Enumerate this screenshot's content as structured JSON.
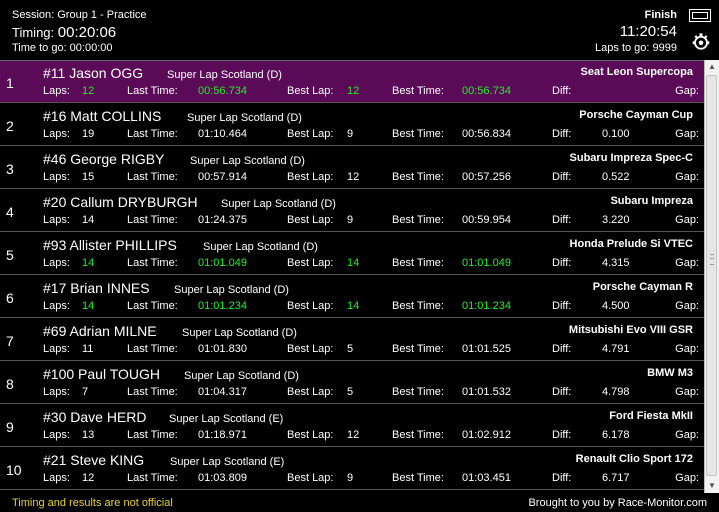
{
  "header": {
    "session": "Session: Group 1 - Practice",
    "timing_label": "Timing:",
    "timing_value": "00:20:06",
    "time_to_go": "Time to go: 00:00:00",
    "finish": "Finish",
    "clock": "11:20:54",
    "laps_to_go": "Laps to go:  9999"
  },
  "labels": {
    "laps": "Laps:",
    "last_time": "Last Time:",
    "best_lap": "Best Lap:",
    "best_time": "Best Time:",
    "diff": "Diff:",
    "gap": "Gap:"
  },
  "rows": [
    {
      "pos": "1",
      "name": "#11 Jason OGG",
      "category": "Super Lap Scotland (D)",
      "car": "Seat Leon Supercopa",
      "laps": "12",
      "last_time": "00:56.734",
      "best_lap": "12",
      "best_time": "00:56.734",
      "diff": ""
    },
    {
      "pos": "2",
      "name": "#16 Matt COLLINS",
      "category": "Super Lap Scotland (D)",
      "car": "Porsche Cayman Cup",
      "laps": "19",
      "last_time": "01:10.464",
      "best_lap": "9",
      "best_time": "00:56.834",
      "diff": "0.100"
    },
    {
      "pos": "3",
      "name": "#46 George RIGBY",
      "category": "Super Lap Scotland (D)",
      "car": "Subaru Impreza Spec-C",
      "laps": "15",
      "last_time": "00:57.914",
      "best_lap": "12",
      "best_time": "00:57.256",
      "diff": "0.522"
    },
    {
      "pos": "4",
      "name": "#20 Callum DRYBURGH",
      "category": "Super Lap Scotland (D)",
      "car": "Subaru Impreza",
      "laps": "14",
      "last_time": "01:24.375",
      "best_lap": "9",
      "best_time": "00:59.954",
      "diff": "3.220"
    },
    {
      "pos": "5",
      "name": "#93 Allister PHILLIPS",
      "category": "Super Lap Scotland (D)",
      "car": "Honda Prelude Si VTEC",
      "laps": "14",
      "last_time": "01:01.049",
      "best_lap": "14",
      "best_time": "01:01.049",
      "diff": "4.315"
    },
    {
      "pos": "6",
      "name": "#17 Brian INNES",
      "category": "Super Lap Scotland (D)",
      "car": "Porsche Cayman R",
      "laps": "14",
      "last_time": "01:01.234",
      "best_lap": "14",
      "best_time": "01:01.234",
      "diff": "4.500"
    },
    {
      "pos": "7",
      "name": "#69 Adrian MILNE",
      "category": "Super Lap Scotland (D)",
      "car": "Mitsubishi Evo VIII GSR",
      "laps": "11",
      "last_time": "01:01.830",
      "best_lap": "5",
      "best_time": "01:01.525",
      "diff": "4.791"
    },
    {
      "pos": "8",
      "name": "#100 Paul TOUGH",
      "category": "Super Lap Scotland (D)",
      "car": "BMW M3",
      "laps": "7",
      "last_time": "01:04.317",
      "best_lap": "5",
      "best_time": "01:01.532",
      "diff": "4.798"
    },
    {
      "pos": "9",
      "name": "#30 Dave HERD",
      "category": "Super Lap Scotland (E)",
      "car": "Ford Fiesta MkII",
      "laps": "13",
      "last_time": "01:18.971",
      "best_lap": "12",
      "best_time": "01:02.912",
      "diff": "6.178"
    },
    {
      "pos": "10",
      "name": "#21 Steve KING",
      "category": "Super Lap Scotland (E)",
      "car": "Renault Clio Sport 172",
      "laps": "12",
      "last_time": "01:03.809",
      "best_lap": "9",
      "best_time": "01:03.451",
      "diff": "6.717"
    }
  ],
  "footer": {
    "disclaimer": "Timing and results are not official",
    "credit": "Brought to you by Race-Monitor.com"
  },
  "colors": {
    "selected_row": "#5a0a57",
    "personal_best": "#22ee22",
    "disclaimer": "#e8d23a"
  },
  "icons": {
    "fullscreen": "fullscreen-icon",
    "settings": "gear-icon"
  }
}
